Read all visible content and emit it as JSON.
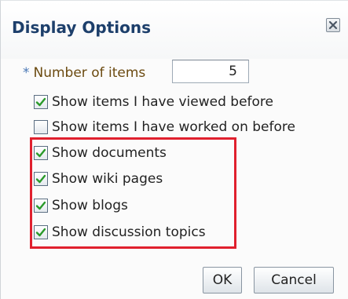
{
  "dialog": {
    "title": "Display Options",
    "close_icon": "close-icon"
  },
  "number_of_items": {
    "required_marker": "*",
    "label": "Number of items",
    "value": "5"
  },
  "options": [
    {
      "label": "Show items I have viewed before",
      "checked": true
    },
    {
      "label": "Show items I have worked on before",
      "checked": false
    },
    {
      "label": "Show documents",
      "checked": true
    },
    {
      "label": "Show wiki pages",
      "checked": true
    },
    {
      "label": "Show blogs",
      "checked": true
    },
    {
      "label": "Show discussion topics",
      "checked": true
    }
  ],
  "buttons": {
    "ok_label": "OK",
    "cancel_label": "Cancel"
  },
  "colors": {
    "title": "#1d3f6b",
    "check": "#2a9a2a",
    "highlight": "#e0202e",
    "field_label": "#6b4a10"
  }
}
